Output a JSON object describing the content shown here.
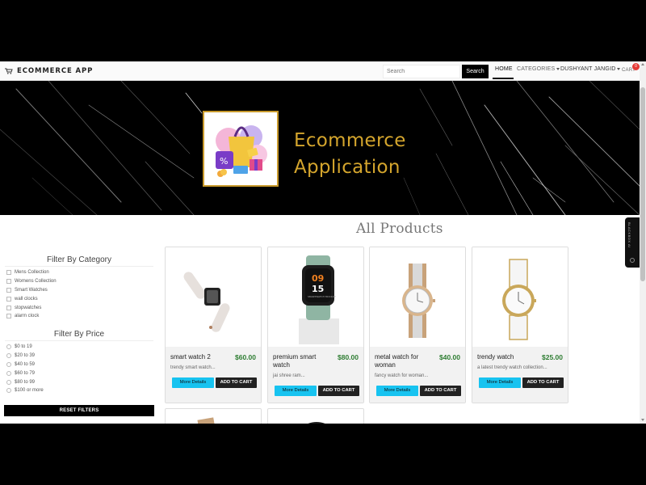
{
  "navbar": {
    "brand": "ECOMMERCE APP",
    "search_placeholder": "Search",
    "search_button": "Search",
    "home": "HOME",
    "categories": "CATEGORIES",
    "user": "DUSHYANT JANGID",
    "cart": "CART",
    "cart_count": "0"
  },
  "banner": {
    "line1": "Ecommerce",
    "line2": "Application"
  },
  "products_title": "All Products",
  "sidebar": {
    "category_title": "Filter By Category",
    "categories": [
      "Mens Collection",
      "Womens Collection",
      "Smart Watches",
      "wall clocks",
      "stopwatches",
      "alarm clock"
    ],
    "price_title": "Filter By Price",
    "prices": [
      "$0 to 19",
      "$20 to 39",
      "$40 to 59",
      "$60 to 79",
      "$80 to 99",
      "$100 or more"
    ],
    "reset_label": "RESET FILTERS"
  },
  "product_buttons": {
    "details": "More Details",
    "add_to_cart": "ADD TO CART"
  },
  "products": [
    {
      "name": "smart watch 2",
      "price": "$60.00",
      "description": "trendy smart watch..."
    },
    {
      "name": "premium smart watch",
      "price": "$80.00",
      "description": "jai shree ram..."
    },
    {
      "name": "metal watch for woman",
      "price": "$40.00",
      "description": "fancy watch for woman..."
    },
    {
      "name": "trendy watch",
      "price": "$25.00",
      "description": "a latest trendy watch collection..."
    }
  ],
  "watch_face": {
    "hours": "09",
    "minutes": "15",
    "caption": "SMARTWATCH MOCKUP"
  },
  "side_widget": "BLACKBOX AI",
  "colors": {
    "accent_gold": "#d4a52d",
    "price_green": "#2e7d32",
    "details_button": "#17c3f0",
    "dark_button": "#222222"
  }
}
